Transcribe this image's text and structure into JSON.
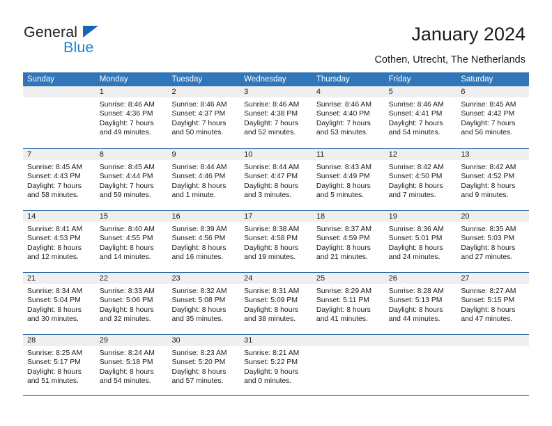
{
  "brand": {
    "name_part1": "General",
    "name_part2": "Blue",
    "triangle_color": "#1668b3",
    "blue_color": "#1982d1"
  },
  "header": {
    "title": "January 2024",
    "subtitle": "Cothen, Utrecht, The Netherlands"
  },
  "theme": {
    "header_bg": "#3176b8",
    "header_text": "#ffffff",
    "week_separator": "#2b6cab",
    "daynum_band_bg": "#efefef",
    "body_text": "#1a1a1a"
  },
  "weekday_headers": [
    "Sunday",
    "Monday",
    "Tuesday",
    "Wednesday",
    "Thursday",
    "Friday",
    "Saturday"
  ],
  "weeks": [
    [
      {
        "day": "",
        "sunrise": "",
        "sunset": "",
        "daylight1": "",
        "daylight2": ""
      },
      {
        "day": "1",
        "sunrise": "Sunrise: 8:46 AM",
        "sunset": "Sunset: 4:36 PM",
        "daylight1": "Daylight: 7 hours",
        "daylight2": "and 49 minutes."
      },
      {
        "day": "2",
        "sunrise": "Sunrise: 8:46 AM",
        "sunset": "Sunset: 4:37 PM",
        "daylight1": "Daylight: 7 hours",
        "daylight2": "and 50 minutes."
      },
      {
        "day": "3",
        "sunrise": "Sunrise: 8:46 AM",
        "sunset": "Sunset: 4:38 PM",
        "daylight1": "Daylight: 7 hours",
        "daylight2": "and 52 minutes."
      },
      {
        "day": "4",
        "sunrise": "Sunrise: 8:46 AM",
        "sunset": "Sunset: 4:40 PM",
        "daylight1": "Daylight: 7 hours",
        "daylight2": "and 53 minutes."
      },
      {
        "day": "5",
        "sunrise": "Sunrise: 8:46 AM",
        "sunset": "Sunset: 4:41 PM",
        "daylight1": "Daylight: 7 hours",
        "daylight2": "and 54 minutes."
      },
      {
        "day": "6",
        "sunrise": "Sunrise: 8:45 AM",
        "sunset": "Sunset: 4:42 PM",
        "daylight1": "Daylight: 7 hours",
        "daylight2": "and 56 minutes."
      }
    ],
    [
      {
        "day": "7",
        "sunrise": "Sunrise: 8:45 AM",
        "sunset": "Sunset: 4:43 PM",
        "daylight1": "Daylight: 7 hours",
        "daylight2": "and 58 minutes."
      },
      {
        "day": "8",
        "sunrise": "Sunrise: 8:45 AM",
        "sunset": "Sunset: 4:44 PM",
        "daylight1": "Daylight: 7 hours",
        "daylight2": "and 59 minutes."
      },
      {
        "day": "9",
        "sunrise": "Sunrise: 8:44 AM",
        "sunset": "Sunset: 4:46 PM",
        "daylight1": "Daylight: 8 hours",
        "daylight2": "and 1 minute."
      },
      {
        "day": "10",
        "sunrise": "Sunrise: 8:44 AM",
        "sunset": "Sunset: 4:47 PM",
        "daylight1": "Daylight: 8 hours",
        "daylight2": "and 3 minutes."
      },
      {
        "day": "11",
        "sunrise": "Sunrise: 8:43 AM",
        "sunset": "Sunset: 4:49 PM",
        "daylight1": "Daylight: 8 hours",
        "daylight2": "and 5 minutes."
      },
      {
        "day": "12",
        "sunrise": "Sunrise: 8:42 AM",
        "sunset": "Sunset: 4:50 PM",
        "daylight1": "Daylight: 8 hours",
        "daylight2": "and 7 minutes."
      },
      {
        "day": "13",
        "sunrise": "Sunrise: 8:42 AM",
        "sunset": "Sunset: 4:52 PM",
        "daylight1": "Daylight: 8 hours",
        "daylight2": "and 9 minutes."
      }
    ],
    [
      {
        "day": "14",
        "sunrise": "Sunrise: 8:41 AM",
        "sunset": "Sunset: 4:53 PM",
        "daylight1": "Daylight: 8 hours",
        "daylight2": "and 12 minutes."
      },
      {
        "day": "15",
        "sunrise": "Sunrise: 8:40 AM",
        "sunset": "Sunset: 4:55 PM",
        "daylight1": "Daylight: 8 hours",
        "daylight2": "and 14 minutes."
      },
      {
        "day": "16",
        "sunrise": "Sunrise: 8:39 AM",
        "sunset": "Sunset: 4:56 PM",
        "daylight1": "Daylight: 8 hours",
        "daylight2": "and 16 minutes."
      },
      {
        "day": "17",
        "sunrise": "Sunrise: 8:38 AM",
        "sunset": "Sunset: 4:58 PM",
        "daylight1": "Daylight: 8 hours",
        "daylight2": "and 19 minutes."
      },
      {
        "day": "18",
        "sunrise": "Sunrise: 8:37 AM",
        "sunset": "Sunset: 4:59 PM",
        "daylight1": "Daylight: 8 hours",
        "daylight2": "and 21 minutes."
      },
      {
        "day": "19",
        "sunrise": "Sunrise: 8:36 AM",
        "sunset": "Sunset: 5:01 PM",
        "daylight1": "Daylight: 8 hours",
        "daylight2": "and 24 minutes."
      },
      {
        "day": "20",
        "sunrise": "Sunrise: 8:35 AM",
        "sunset": "Sunset: 5:03 PM",
        "daylight1": "Daylight: 8 hours",
        "daylight2": "and 27 minutes."
      }
    ],
    [
      {
        "day": "21",
        "sunrise": "Sunrise: 8:34 AM",
        "sunset": "Sunset: 5:04 PM",
        "daylight1": "Daylight: 8 hours",
        "daylight2": "and 30 minutes."
      },
      {
        "day": "22",
        "sunrise": "Sunrise: 8:33 AM",
        "sunset": "Sunset: 5:06 PM",
        "daylight1": "Daylight: 8 hours",
        "daylight2": "and 32 minutes."
      },
      {
        "day": "23",
        "sunrise": "Sunrise: 8:32 AM",
        "sunset": "Sunset: 5:08 PM",
        "daylight1": "Daylight: 8 hours",
        "daylight2": "and 35 minutes."
      },
      {
        "day": "24",
        "sunrise": "Sunrise: 8:31 AM",
        "sunset": "Sunset: 5:09 PM",
        "daylight1": "Daylight: 8 hours",
        "daylight2": "and 38 minutes."
      },
      {
        "day": "25",
        "sunrise": "Sunrise: 8:29 AM",
        "sunset": "Sunset: 5:11 PM",
        "daylight1": "Daylight: 8 hours",
        "daylight2": "and 41 minutes."
      },
      {
        "day": "26",
        "sunrise": "Sunrise: 8:28 AM",
        "sunset": "Sunset: 5:13 PM",
        "daylight1": "Daylight: 8 hours",
        "daylight2": "and 44 minutes."
      },
      {
        "day": "27",
        "sunrise": "Sunrise: 8:27 AM",
        "sunset": "Sunset: 5:15 PM",
        "daylight1": "Daylight: 8 hours",
        "daylight2": "and 47 minutes."
      }
    ],
    [
      {
        "day": "28",
        "sunrise": "Sunrise: 8:25 AM",
        "sunset": "Sunset: 5:17 PM",
        "daylight1": "Daylight: 8 hours",
        "daylight2": "and 51 minutes."
      },
      {
        "day": "29",
        "sunrise": "Sunrise: 8:24 AM",
        "sunset": "Sunset: 5:18 PM",
        "daylight1": "Daylight: 8 hours",
        "daylight2": "and 54 minutes."
      },
      {
        "day": "30",
        "sunrise": "Sunrise: 8:23 AM",
        "sunset": "Sunset: 5:20 PM",
        "daylight1": "Daylight: 8 hours",
        "daylight2": "and 57 minutes."
      },
      {
        "day": "31",
        "sunrise": "Sunrise: 8:21 AM",
        "sunset": "Sunset: 5:22 PM",
        "daylight1": "Daylight: 9 hours",
        "daylight2": "and 0 minutes."
      },
      {
        "day": "",
        "sunrise": "",
        "sunset": "",
        "daylight1": "",
        "daylight2": ""
      },
      {
        "day": "",
        "sunrise": "",
        "sunset": "",
        "daylight1": "",
        "daylight2": ""
      },
      {
        "day": "",
        "sunrise": "",
        "sunset": "",
        "daylight1": "",
        "daylight2": ""
      }
    ]
  ]
}
